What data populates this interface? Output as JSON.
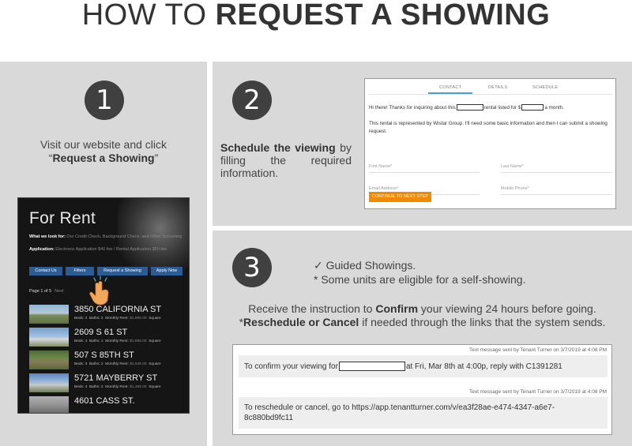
{
  "header": {
    "title_light": "HOW TO ",
    "title_bold": "REQUEST A SHOWING"
  },
  "steps": [
    {
      "number": "1",
      "text_before": "Visit our website and click",
      "text_quote_open": "“",
      "text_bold": "Request a Showing",
      "text_quote_close": "”"
    },
    {
      "number": "2",
      "text_bold": "Schedule the viewing",
      "text_after": " by filling the required information."
    },
    {
      "number": "3",
      "guided_line": "Guided Showings.",
      "check_glyph": "✓",
      "self_line": "* Some units are eligible for a self-showing.",
      "instr_before": "Receive the instruction to ",
      "instr_bold_1": "Confirm",
      "instr_mid": " your viewing 24 hours before going.",
      "instr_star": "*",
      "instr_bold_2": "Reschedule or Cancel",
      "instr_after": " if needed through the links that the system sends."
    }
  ],
  "website": {
    "title": "For Rent",
    "line1_bold": "What we look for:",
    "line1_text": " Our Credit Check, Background Check, and Other Screening",
    "line2_bold": "Application:",
    "line2_text": " Electronic Application $40 fee / Rental Application $50 fee",
    "buttons": [
      "Contact Us",
      "Filters",
      "Request a Showing",
      "Apply Now"
    ],
    "pager": "Page 1 of 5",
    "pager_next": "Next",
    "listings": [
      {
        "address": "3850 CALIFORNIA ST",
        "beds": "Beds: 4",
        "baths": "Baths: 2",
        "rent_label": "Monthly Rent:",
        "rent": "$1,995.00",
        "sq": "Square"
      },
      {
        "address": "2609 S 61 ST",
        "beds": "Beds: 4",
        "baths": "Baths: 1",
        "rent_label": "Monthly Rent:",
        "rent": "$1,895.00",
        "sq": "Square"
      },
      {
        "address": "507 S 85TH ST",
        "beds": "Beds: 3",
        "baths": "Baths: 2",
        "rent_label": "Monthly Rent:",
        "rent": "$1,645.00",
        "sq": "Square"
      },
      {
        "address": "5721 MAYBERRY ST",
        "beds": "Beds: 4",
        "baths": "Baths: 2",
        "rent_label": "Monthly Rent:",
        "rent": "$1,495.00",
        "sq": "Square"
      },
      {
        "address": "4601 CASS ST.",
        "beds": "",
        "baths": "",
        "rent_label": "",
        "rent": "",
        "sq": ""
      }
    ]
  },
  "form": {
    "tabs": [
      "CONTACT",
      "DETAILS",
      "SCHEDULE"
    ],
    "intro_1": "Hi there! Thanks for inquiring about this",
    "intro_2": "rental listed for $",
    "intro_3": "a month.",
    "repr": "This rental is represented by Wistar Group. I'll need some basic information and then I can submit a showing request.",
    "first_name": "First Name*",
    "last_name": "Last Name*",
    "email": "Email Address*",
    "mobile": "Mobile Phone*",
    "continue": "CONTINUE TO NEXT STEP"
  },
  "sms": {
    "meta_1": "Text message sent by Tenant Turner on 3/7/2019 at 4:08 PM",
    "bubble_1_a": "To confirm your viewing for",
    "bubble_1_b": "at Fri, Mar 8th at 4:00p, reply with C1391281",
    "meta_2": "Text message sent by Tenant Turner on 3/7/2019 at 4:08 PM",
    "bubble_2": "To reschedule or cancel, go to https://app.tenantturner.com/v/ea3f28ae-e474-4347-a6e7-8c880bd9fc11"
  }
}
